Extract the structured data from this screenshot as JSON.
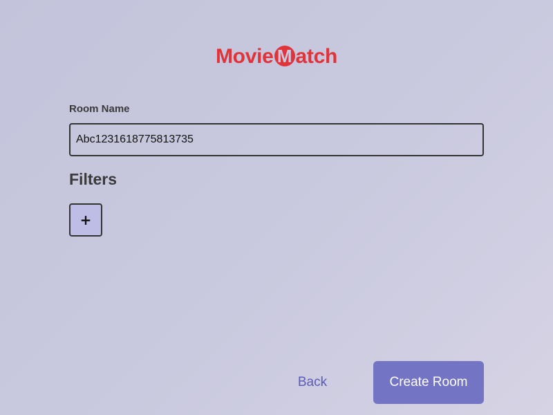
{
  "logo": {
    "prefix": "Movie",
    "circled": "M",
    "suffix": "atch",
    "color": "#e0333a"
  },
  "form": {
    "room_name_label": "Room Name",
    "room_name_value": "Abc1231618775813735",
    "filters_heading": "Filters",
    "add_filter_label": "+"
  },
  "actions": {
    "back_label": "Back",
    "create_label": "Create Room",
    "accent": "#7474c4"
  }
}
